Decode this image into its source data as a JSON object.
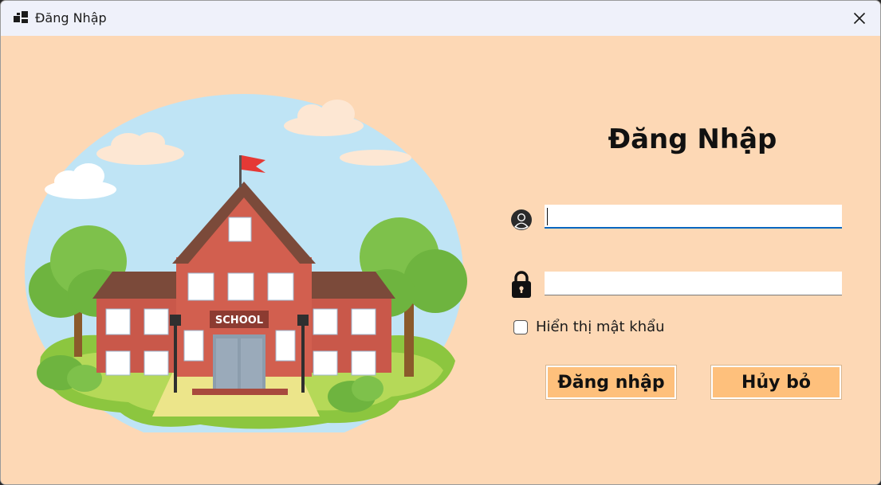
{
  "window": {
    "title": "Đăng Nhập"
  },
  "illustration": {
    "school_sign": "SCHOOL"
  },
  "form": {
    "heading": "Đăng Nhập",
    "username": {
      "value": "",
      "placeholder": ""
    },
    "password": {
      "value": "",
      "placeholder": ""
    },
    "show_password_label": "Hiển thị mật khẩu",
    "show_password_checked": false,
    "login_button": "Đăng nhập",
    "cancel_button": "Hủy bỏ"
  },
  "icons": {
    "app": "app-window-icon",
    "close": "close-icon",
    "username": "user-icon",
    "password": "lock-icon"
  },
  "colors": {
    "background": "#fdd8b5",
    "titlebar": "#eff1fa",
    "button": "#fec07c",
    "focus_underline": "#0067c0"
  }
}
